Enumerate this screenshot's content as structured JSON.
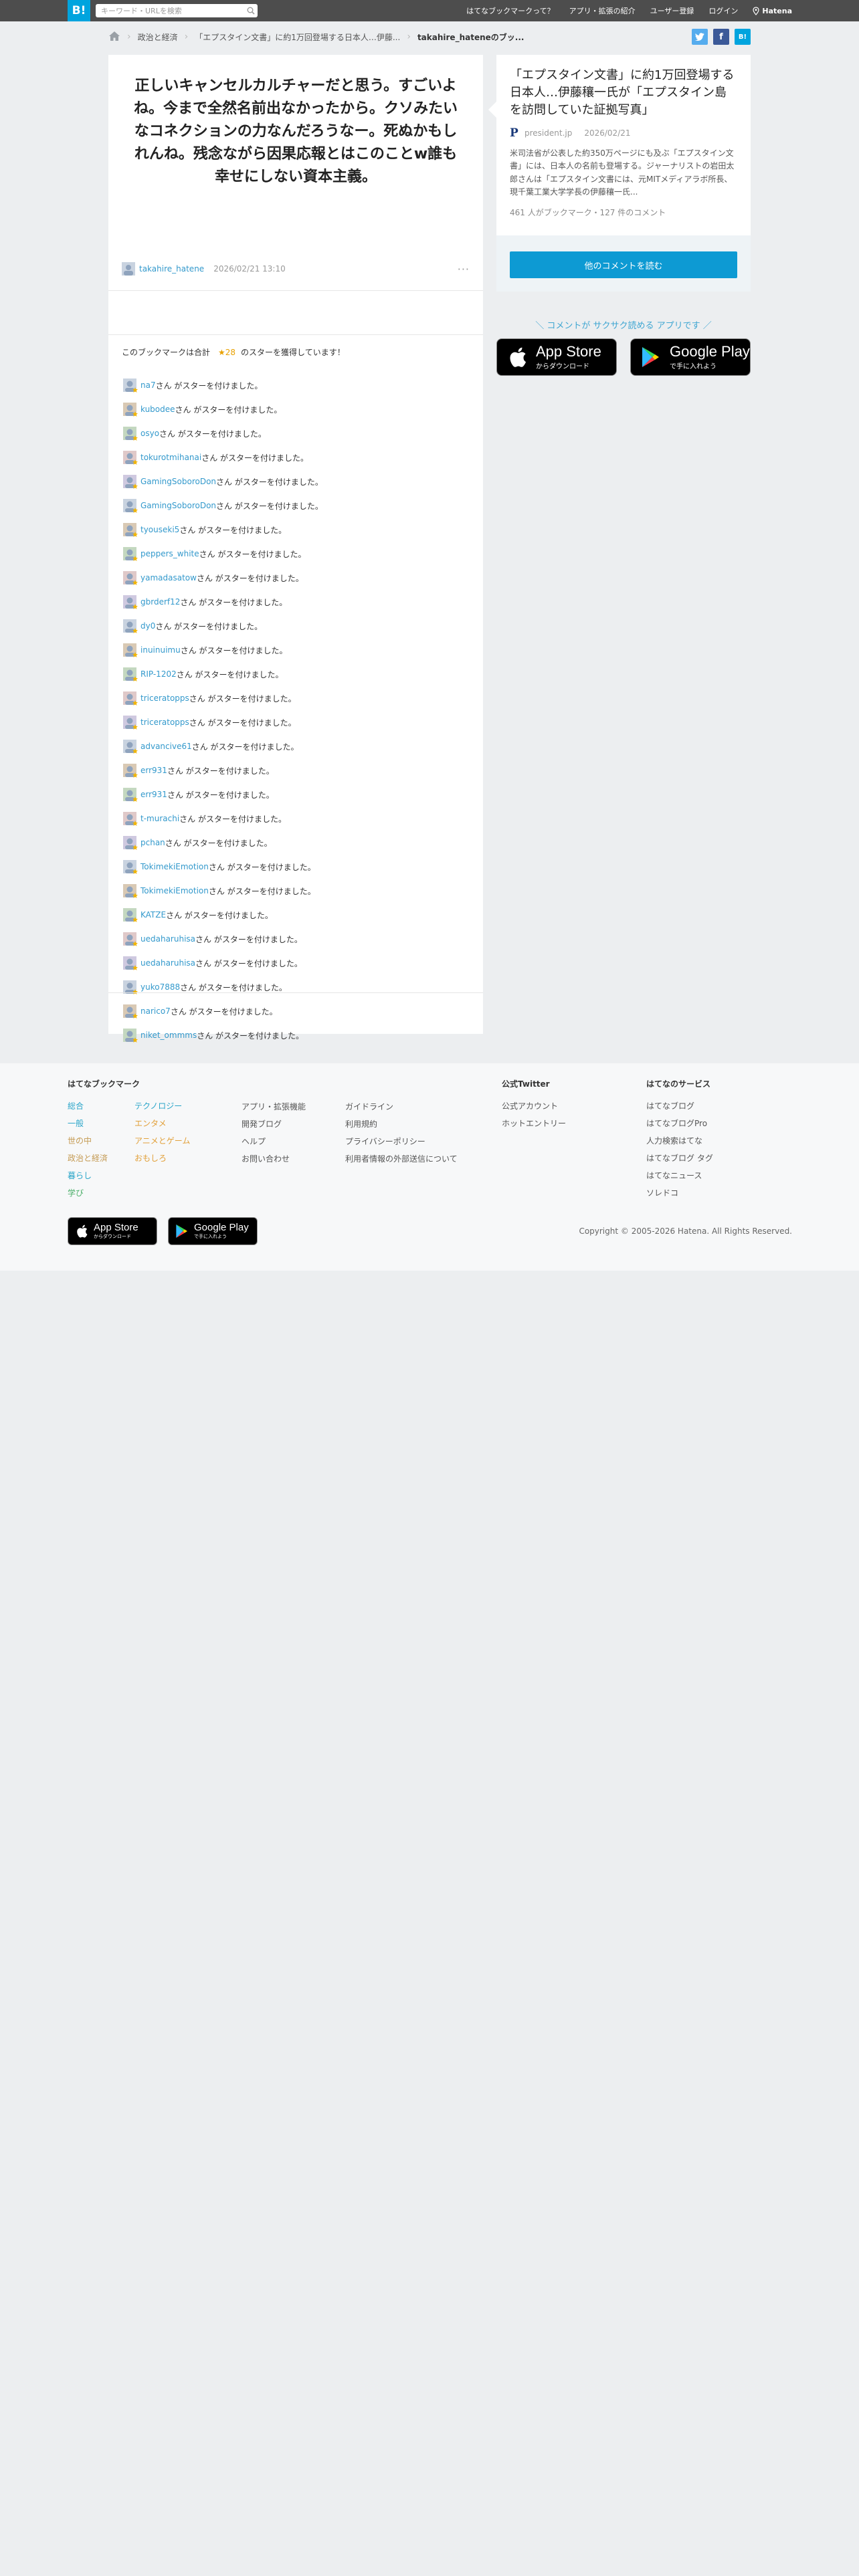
{
  "topbar": {
    "logo": "B!",
    "search_placeholder": "キーワード・URLを検索",
    "nav": [
      "はてなブックマークって？",
      "アプリ・拡張の紹介",
      "ユーザー登録",
      "ログイン"
    ],
    "brand": "Hatena"
  },
  "breadcrumb": {
    "items": [
      "政治と経済",
      "「エプスタイン文書」に約1万回登場する日本人…伊藤...",
      "takahire_hateneのブッ..."
    ]
  },
  "share": {
    "twitter": "t",
    "facebook": "f",
    "hatena": "B!"
  },
  "comment": {
    "text": "正しいキャンセルカルチャーだと思う。すごいよね。今まで全然名前出なかったから。クソみたいなコネクションの力なんだろうなー。死ぬかもしれんね。残念ながら因果応報とはこのことw誰も幸せにしない資本主義。",
    "user": "takahire_hatene",
    "date": "2026/02/21 13:10",
    "more": "···"
  },
  "stars": {
    "summary_prefix": "このブックマークは合計",
    "count": "★28",
    "summary_suffix": "のスターを獲得しています！",
    "suffix_text": "さん がスターを付けました。",
    "users": [
      "na7",
      "kubodee",
      "osyo",
      "tokurotmihanai",
      "GamingSoboroDon",
      "GamingSoboroDon",
      "tyouseki5",
      "peppers_white",
      "yamadasatow",
      "gbrderf12",
      "dy0",
      "inuinuimu",
      "RIP-1202",
      "triceratopps",
      "triceratopps",
      "advancive61",
      "err931",
      "err931",
      "t-murachi",
      "pchan",
      "TokimekiEmotion",
      "TokimekiEmotion",
      "KATZE",
      "uedaharuhisa",
      "uedaharuhisa",
      "yuko7888",
      "narico7",
      "niket_ommms"
    ]
  },
  "entry": {
    "title": "「エプスタイン文書」に約1万回登場する日本人…伊藤穰一氏が「エプスタイン島を訪問していた証拠写真」",
    "source": "president.jp",
    "date": "2026/02/21",
    "description": "米司法省が公表した約350万ページにも及ぶ「エプスタイン文書」には、日本人の名前も登場する。ジャーナリストの岩田太郎さんは「エプスタイン文書には、元MITメディアラボ所長、現千葉工業大学学長の伊藤穰一氏...",
    "count": "461 人がブックマーク・127 件のコメント",
    "button": "他のコメントを読む"
  },
  "promo": "＼ コメントが サクサク読める アプリです ／",
  "appstore": {
    "big": "App Store",
    "small": "からダウンロード"
  },
  "googleplay": {
    "big": "Google Play",
    "small": "で手に入れよう"
  },
  "footer": {
    "bookmark_title": "はてなブックマーク",
    "categories_col1": [
      "総合",
      "一般",
      "世の中",
      "政治と経済",
      "暮らし",
      "学び"
    ],
    "categories_col2": [
      "テクノロジー",
      "エンタメ",
      "アニメとゲーム",
      "おもしろ"
    ],
    "links_col3": [
      "アプリ・拡張機能",
      "開発ブログ",
      "ヘルプ",
      "お問い合わせ"
    ],
    "links_col4": [
      "ガイドライン",
      "利用規約",
      "プライバシーポリシー",
      "利用者情報の外部送信について"
    ],
    "twitter_title": "公式Twitter",
    "twitter_links": [
      "公式アカウント",
      "ホットエントリー"
    ],
    "services_title": "はてなのサービス",
    "services": [
      "はてなブログ",
      "はてなブログPro",
      "人力検索はてな",
      "はてなブログ タグ",
      "はてなニュース",
      "ソレドコ"
    ],
    "copyright": "Copyright © 2005-2026 Hatena. All Rights Reserved."
  },
  "colors": {
    "topbar": "#4d4d4d",
    "accent": "#00a4de",
    "link": "#3399cc",
    "star": "#e8a100",
    "category_blue": "#2aa5c9",
    "category_orange": "#e2a13b",
    "category_green": "#4caf6a"
  }
}
